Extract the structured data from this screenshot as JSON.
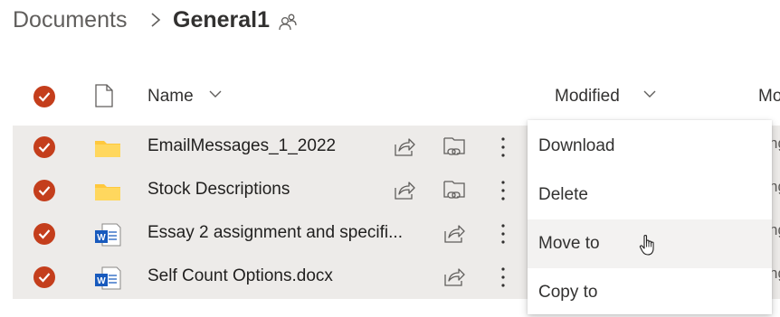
{
  "breadcrumb": {
    "root": "Documents",
    "current": "General1",
    "separator_icon": "chevron-right-icon",
    "shared_icon": "people-icon"
  },
  "header": {
    "name_label": "Name",
    "modified_label": "Modified",
    "next_column_label": "Mo"
  },
  "rows": [
    {
      "name": "EmailMessages_1_2022",
      "type": "folder",
      "selected": true,
      "modified_cutoff": "ng"
    },
    {
      "name": "Stock Descriptions",
      "type": "folder",
      "selected": true,
      "modified_cutoff": "ng"
    },
    {
      "name": "Essay 2 assignment and specifi...",
      "type": "word",
      "selected": true,
      "modified_cutoff": "ng"
    },
    {
      "name": "Self Count Options.docx",
      "type": "word",
      "selected": true,
      "modified_cutoff": "ng"
    }
  ],
  "menu": {
    "items": [
      {
        "label": "Download"
      },
      {
        "label": "Delete"
      },
      {
        "label": "Move to",
        "hovered": true
      },
      {
        "label": "Copy to"
      }
    ]
  },
  "colors": {
    "accent_check": "#c43e1c",
    "selection_band": "#edebe9",
    "folder": "#ffc83d",
    "word": "#185abd"
  }
}
